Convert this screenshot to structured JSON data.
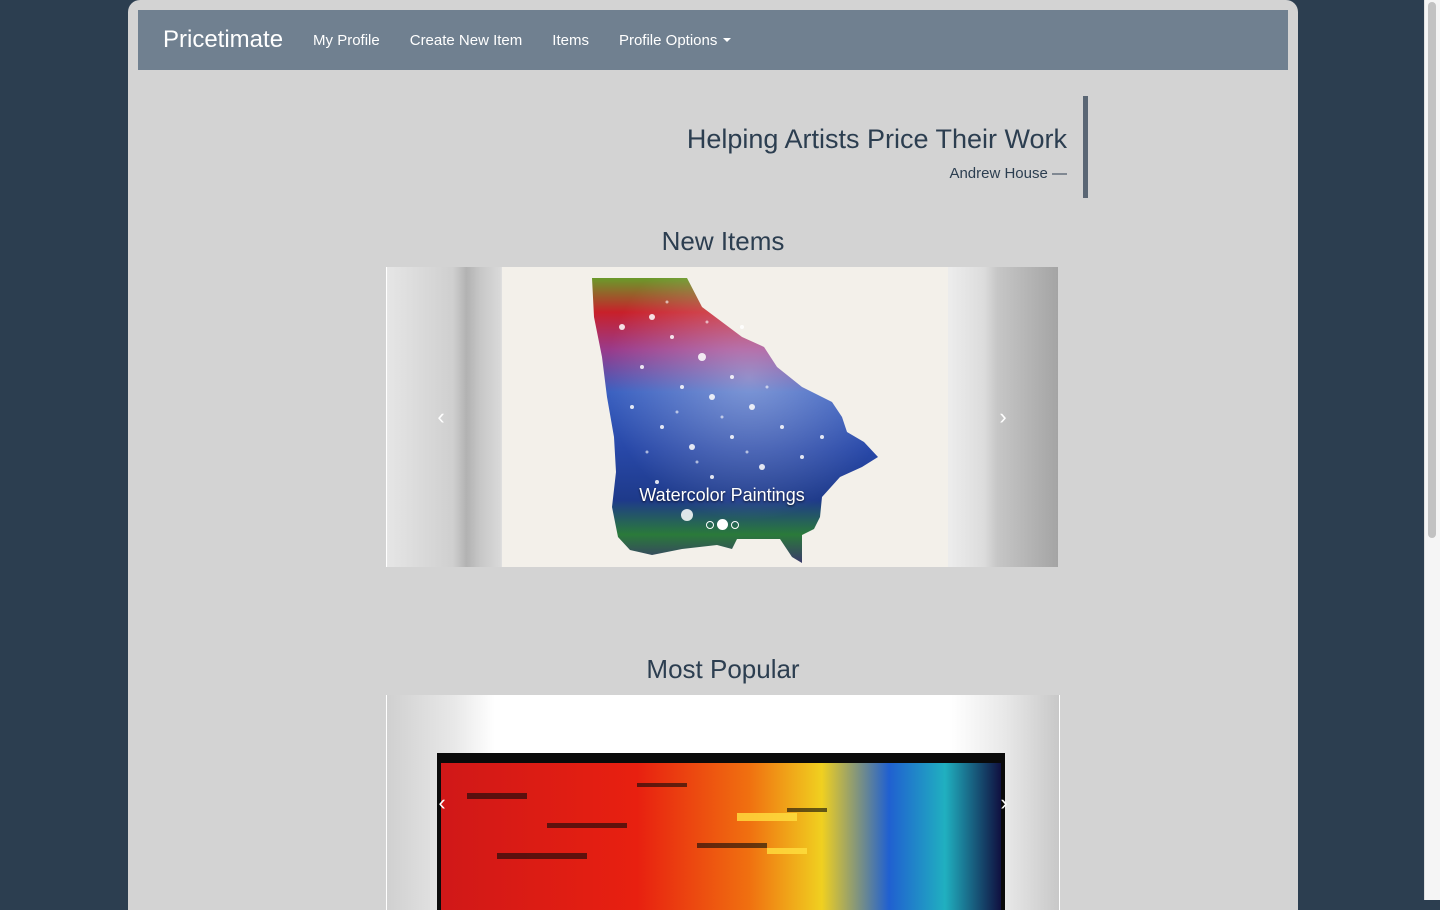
{
  "navbar": {
    "brand": "Pricetimate",
    "items": [
      {
        "label": "My Profile"
      },
      {
        "label": "Create New Item"
      },
      {
        "label": "Items"
      },
      {
        "label": "Profile Options",
        "dropdown": true
      }
    ]
  },
  "quote": {
    "text": "Helping Artists Price Their Work",
    "author": "Andrew House —"
  },
  "new_items": {
    "title": "New Items",
    "caption": "Watercolor Paintings",
    "prev_icon": "chevron-left-icon",
    "next_icon": "chevron-right-icon",
    "prev_glyph": "‹",
    "next_glyph": "›",
    "active_slide": 2,
    "slide_count": 3
  },
  "most_popular": {
    "title": "Most Popular",
    "prev_glyph": "‹",
    "next_glyph": "›"
  },
  "colors": {
    "background": "#2c3e50",
    "page": "#d3d3d3",
    "navbar": "#708090",
    "text": "#2c3e50"
  }
}
